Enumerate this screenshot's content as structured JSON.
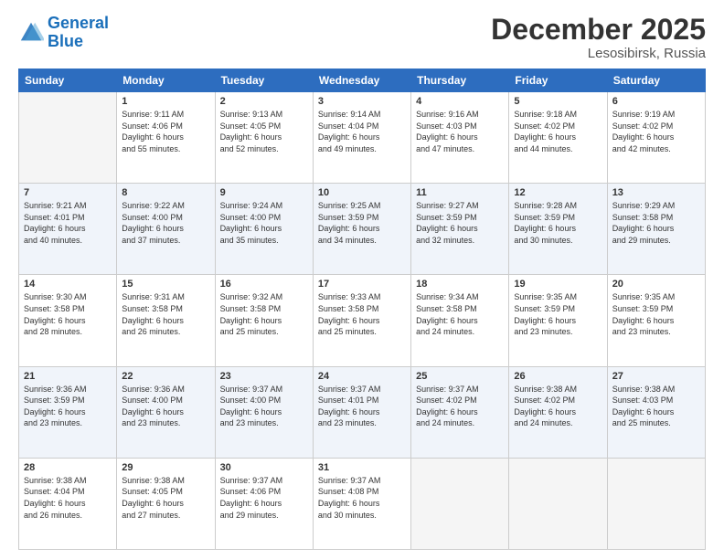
{
  "logo": {
    "line1": "General",
    "line2": "Blue"
  },
  "title": "December 2025",
  "location": "Lesosibirsk, Russia",
  "header_days": [
    "Sunday",
    "Monday",
    "Tuesday",
    "Wednesday",
    "Thursday",
    "Friday",
    "Saturday"
  ],
  "weeks": [
    [
      {
        "day": "",
        "content": ""
      },
      {
        "day": "1",
        "content": "Sunrise: 9:11 AM\nSunset: 4:06 PM\nDaylight: 6 hours\nand 55 minutes."
      },
      {
        "day": "2",
        "content": "Sunrise: 9:13 AM\nSunset: 4:05 PM\nDaylight: 6 hours\nand 52 minutes."
      },
      {
        "day": "3",
        "content": "Sunrise: 9:14 AM\nSunset: 4:04 PM\nDaylight: 6 hours\nand 49 minutes."
      },
      {
        "day": "4",
        "content": "Sunrise: 9:16 AM\nSunset: 4:03 PM\nDaylight: 6 hours\nand 47 minutes."
      },
      {
        "day": "5",
        "content": "Sunrise: 9:18 AM\nSunset: 4:02 PM\nDaylight: 6 hours\nand 44 minutes."
      },
      {
        "day": "6",
        "content": "Sunrise: 9:19 AM\nSunset: 4:02 PM\nDaylight: 6 hours\nand 42 minutes."
      }
    ],
    [
      {
        "day": "7",
        "content": "Sunrise: 9:21 AM\nSunset: 4:01 PM\nDaylight: 6 hours\nand 40 minutes."
      },
      {
        "day": "8",
        "content": "Sunrise: 9:22 AM\nSunset: 4:00 PM\nDaylight: 6 hours\nand 37 minutes."
      },
      {
        "day": "9",
        "content": "Sunrise: 9:24 AM\nSunset: 4:00 PM\nDaylight: 6 hours\nand 35 minutes."
      },
      {
        "day": "10",
        "content": "Sunrise: 9:25 AM\nSunset: 3:59 PM\nDaylight: 6 hours\nand 34 minutes."
      },
      {
        "day": "11",
        "content": "Sunrise: 9:27 AM\nSunset: 3:59 PM\nDaylight: 6 hours\nand 32 minutes."
      },
      {
        "day": "12",
        "content": "Sunrise: 9:28 AM\nSunset: 3:59 PM\nDaylight: 6 hours\nand 30 minutes."
      },
      {
        "day": "13",
        "content": "Sunrise: 9:29 AM\nSunset: 3:58 PM\nDaylight: 6 hours\nand 29 minutes."
      }
    ],
    [
      {
        "day": "14",
        "content": "Sunrise: 9:30 AM\nSunset: 3:58 PM\nDaylight: 6 hours\nand 28 minutes."
      },
      {
        "day": "15",
        "content": "Sunrise: 9:31 AM\nSunset: 3:58 PM\nDaylight: 6 hours\nand 26 minutes."
      },
      {
        "day": "16",
        "content": "Sunrise: 9:32 AM\nSunset: 3:58 PM\nDaylight: 6 hours\nand 25 minutes."
      },
      {
        "day": "17",
        "content": "Sunrise: 9:33 AM\nSunset: 3:58 PM\nDaylight: 6 hours\nand 25 minutes."
      },
      {
        "day": "18",
        "content": "Sunrise: 9:34 AM\nSunset: 3:58 PM\nDaylight: 6 hours\nand 24 minutes."
      },
      {
        "day": "19",
        "content": "Sunrise: 9:35 AM\nSunset: 3:59 PM\nDaylight: 6 hours\nand 23 minutes."
      },
      {
        "day": "20",
        "content": "Sunrise: 9:35 AM\nSunset: 3:59 PM\nDaylight: 6 hours\nand 23 minutes."
      }
    ],
    [
      {
        "day": "21",
        "content": "Sunrise: 9:36 AM\nSunset: 3:59 PM\nDaylight: 6 hours\nand 23 minutes."
      },
      {
        "day": "22",
        "content": "Sunrise: 9:36 AM\nSunset: 4:00 PM\nDaylight: 6 hours\nand 23 minutes."
      },
      {
        "day": "23",
        "content": "Sunrise: 9:37 AM\nSunset: 4:00 PM\nDaylight: 6 hours\nand 23 minutes."
      },
      {
        "day": "24",
        "content": "Sunrise: 9:37 AM\nSunset: 4:01 PM\nDaylight: 6 hours\nand 23 minutes."
      },
      {
        "day": "25",
        "content": "Sunrise: 9:37 AM\nSunset: 4:02 PM\nDaylight: 6 hours\nand 24 minutes."
      },
      {
        "day": "26",
        "content": "Sunrise: 9:38 AM\nSunset: 4:02 PM\nDaylight: 6 hours\nand 24 minutes."
      },
      {
        "day": "27",
        "content": "Sunrise: 9:38 AM\nSunset: 4:03 PM\nDaylight: 6 hours\nand 25 minutes."
      }
    ],
    [
      {
        "day": "28",
        "content": "Sunrise: 9:38 AM\nSunset: 4:04 PM\nDaylight: 6 hours\nand 26 minutes."
      },
      {
        "day": "29",
        "content": "Sunrise: 9:38 AM\nSunset: 4:05 PM\nDaylight: 6 hours\nand 27 minutes."
      },
      {
        "day": "30",
        "content": "Sunrise: 9:37 AM\nSunset: 4:06 PM\nDaylight: 6 hours\nand 29 minutes."
      },
      {
        "day": "31",
        "content": "Sunrise: 9:37 AM\nSunset: 4:08 PM\nDaylight: 6 hours\nand 30 minutes."
      },
      {
        "day": "",
        "content": ""
      },
      {
        "day": "",
        "content": ""
      },
      {
        "day": "",
        "content": ""
      }
    ]
  ]
}
